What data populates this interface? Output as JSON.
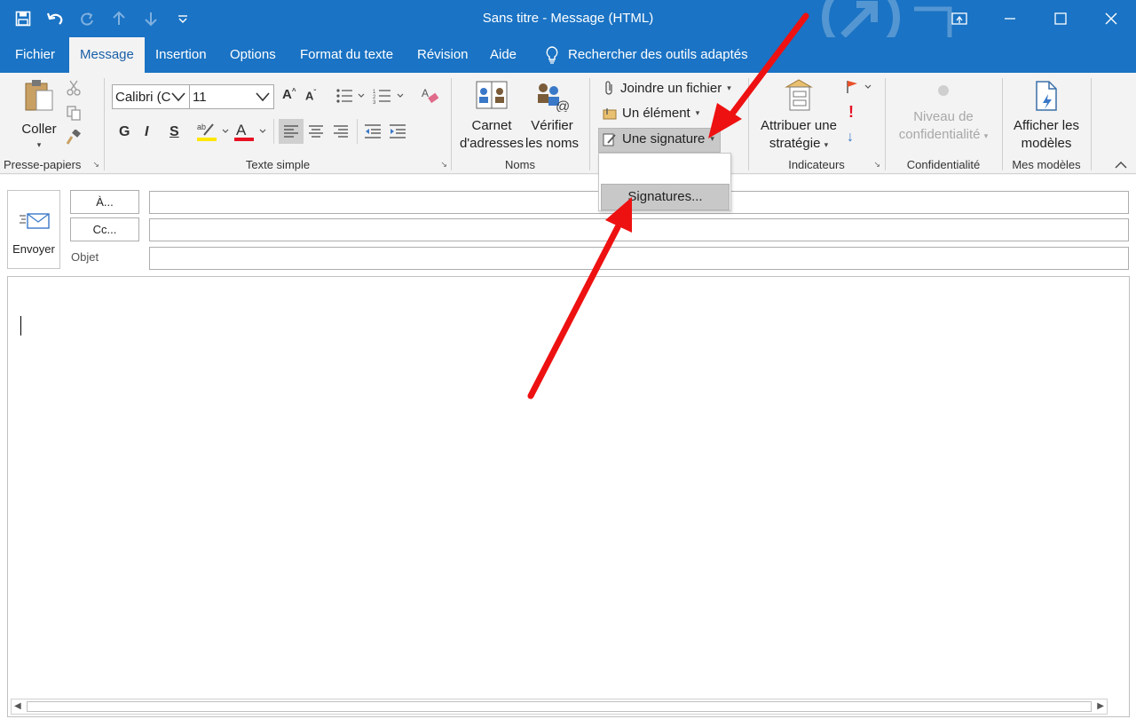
{
  "window": {
    "title": "Sans titre  -  Message (HTML)",
    "accent": "#1a73c4"
  },
  "qat": [
    "save-icon",
    "undo-icon",
    "redo-icon",
    "up-arrow-icon",
    "down-arrow-icon",
    "customize-icon"
  ],
  "tabs": [
    {
      "label": "Fichier"
    },
    {
      "label": "Message"
    },
    {
      "label": "Insertion"
    },
    {
      "label": "Options"
    },
    {
      "label": "Format du texte"
    },
    {
      "label": "Révision"
    },
    {
      "label": "Aide"
    }
  ],
  "search": {
    "label": "Rechercher des outils adaptés"
  },
  "ribbon": {
    "clipboard": {
      "paste": "Coller",
      "group": "Presse-papiers"
    },
    "basic_text": {
      "font": "Calibri (C",
      "size": "11",
      "bold": "G",
      "italic": "I",
      "underline": "S",
      "group": "Texte simple"
    },
    "names": {
      "address_book_1": "Carnet",
      "address_book_2": "d'adresses",
      "check_names_1": "Vérifier",
      "check_names_2": "les noms",
      "group": "Noms"
    },
    "include": {
      "attach": "Joindre un fichier",
      "item": "Un élément",
      "signature": "Une signature"
    },
    "tags": {
      "policy_1": "Attribuer une",
      "policy_2": "stratégie",
      "group": "Indicateurs"
    },
    "sensitivity": {
      "level_1": "Niveau de",
      "level_2": "confidentialité",
      "group": "Confidentialité"
    },
    "templates": {
      "view_1": "Afficher les",
      "view_2": "modèles",
      "group": "Mes modèles"
    }
  },
  "signature_menu": {
    "item": "Signatures..."
  },
  "compose": {
    "send": "Envoyer",
    "to": "À...",
    "cc": "Cc...",
    "subject": "Objet"
  },
  "annotation_color": "#ee1111"
}
